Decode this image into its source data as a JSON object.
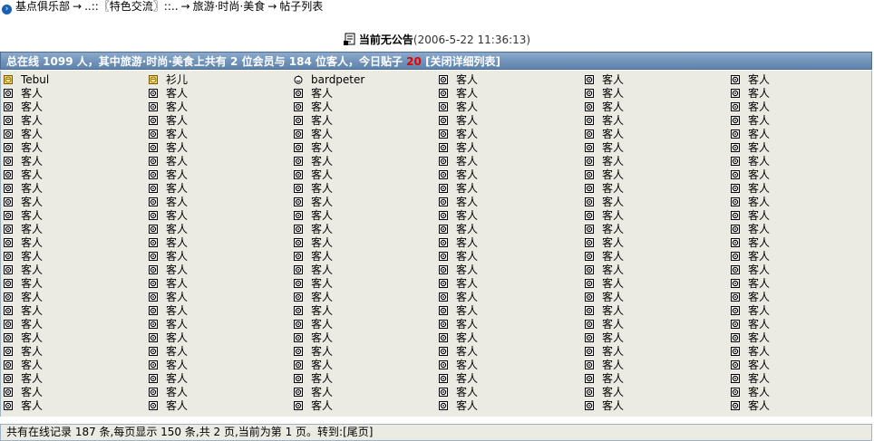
{
  "breadcrumb": {
    "items": [
      "基点俱乐部",
      "..::〖特色交流〗::..",
      "旅游·时尚·美食",
      "帖子列表"
    ],
    "separator": "→"
  },
  "announcement": {
    "label": "当前无公告",
    "time": "(2006-5-22 11:36:13)"
  },
  "header": {
    "prefix": "总在线 1099 人，其中旅游·时尚·美食上共有 2 位会员与 184 位客人，今日贴子",
    "today_posts": "20",
    "toggle_label": "[关闭详细列表]"
  },
  "users": {
    "members": [
      {
        "name": "Tebul",
        "icon": "member-face-icon"
      },
      {
        "name": "衫儿",
        "icon": "member-face-icon"
      },
      {
        "name": "bardpeter",
        "icon": "member-smile-icon"
      }
    ],
    "guest_label": "客人",
    "guest_icon": "guest-icon",
    "columns": 6,
    "rows": 25
  },
  "footer": {
    "text": "共有在线记录 187 条,每页显示 150 条,共 2 页,当前为第 1 页。转到:",
    "last_page_link": "[尾页]"
  },
  "colors": {
    "header_bg": "#6f8fb6",
    "grid_bg": "#ecebe3",
    "post_count": "#e60000"
  }
}
